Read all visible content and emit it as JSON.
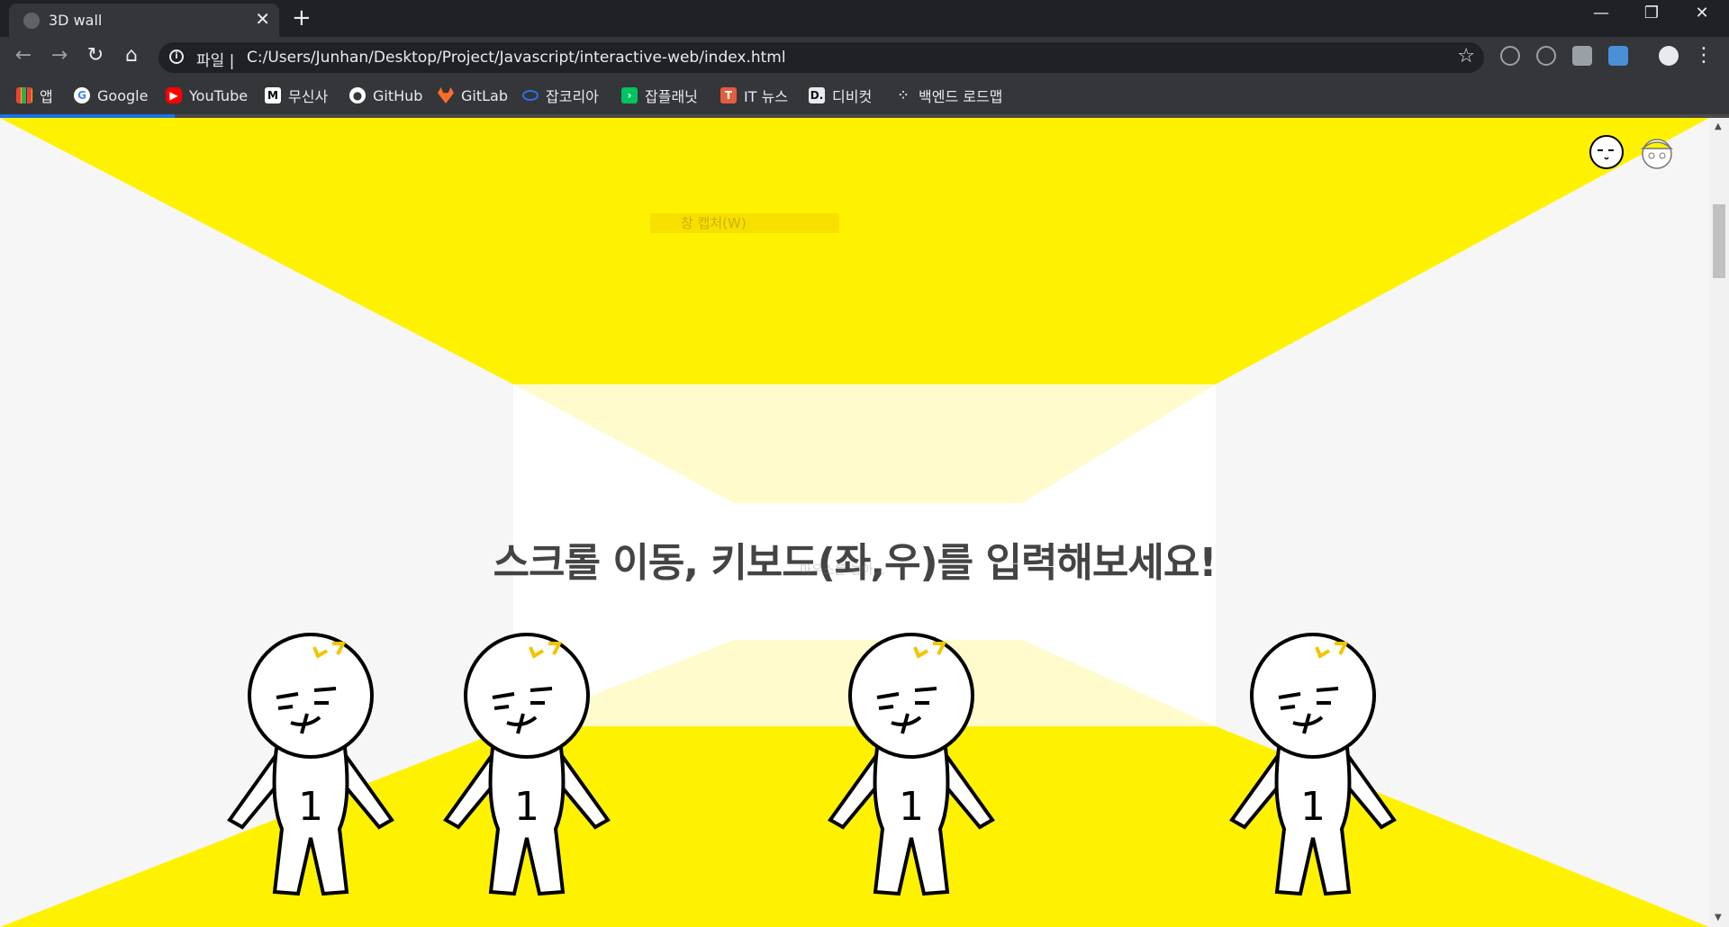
{
  "tab": {
    "title": "3D wall",
    "close": "✕"
  },
  "window_controls": {
    "minimize": "—",
    "restore": "❐",
    "close": "✕"
  },
  "toolbar": {
    "back": "←",
    "forward": "→",
    "reload": "↻",
    "home": "⌂",
    "scheme_label": "파일 |",
    "url": "C:/Users/Junhan/Desktop/Project/Javascript/interactive-web/index.html",
    "star": "☆",
    "menu": "⋮"
  },
  "bookmarks": [
    {
      "label": "앱",
      "icon": "apps-grid-icon"
    },
    {
      "label": "Google",
      "icon": "google-icon",
      "color": "#4285f4"
    },
    {
      "label": "YouTube",
      "icon": "youtube-icon",
      "color": "#ff0000"
    },
    {
      "label": "무신사",
      "icon": "musinsa-icon",
      "color": "#000000"
    },
    {
      "label": "GitHub",
      "icon": "github-icon",
      "color": "#ffffff"
    },
    {
      "label": "GitLab",
      "icon": "gitlab-icon",
      "color": "#fc6d26"
    },
    {
      "label": "잡코리아",
      "icon": "jobkorea-icon",
      "color": "#2f6fe8"
    },
    {
      "label": "잡플래닛",
      "icon": "jobplanet-icon",
      "color": "#00c362"
    },
    {
      "label": "IT 뉴스",
      "icon": "it-news-icon",
      "color": "#e35d3f"
    },
    {
      "label": "디비컷",
      "icon": "dbcut-icon",
      "color": "#111111"
    },
    {
      "label": "백엔드 로드맵",
      "icon": "roadmap-icon",
      "color": "#e8eaed"
    }
  ],
  "page": {
    "heading": "스크롤 이동, 키보드(좌,우)를 입력해보세요!",
    "faint_menu": "창 캡처(W)",
    "faint_text": "마우스를 놓아..."
  },
  "colors": {
    "wall_yellow": "#fff200",
    "floor_light": "#f6f6f6",
    "accent_blue": "#1a73e8"
  },
  "characters": [
    {
      "number": "1"
    },
    {
      "number": "1"
    },
    {
      "number": "1"
    },
    {
      "number": "1"
    }
  ]
}
